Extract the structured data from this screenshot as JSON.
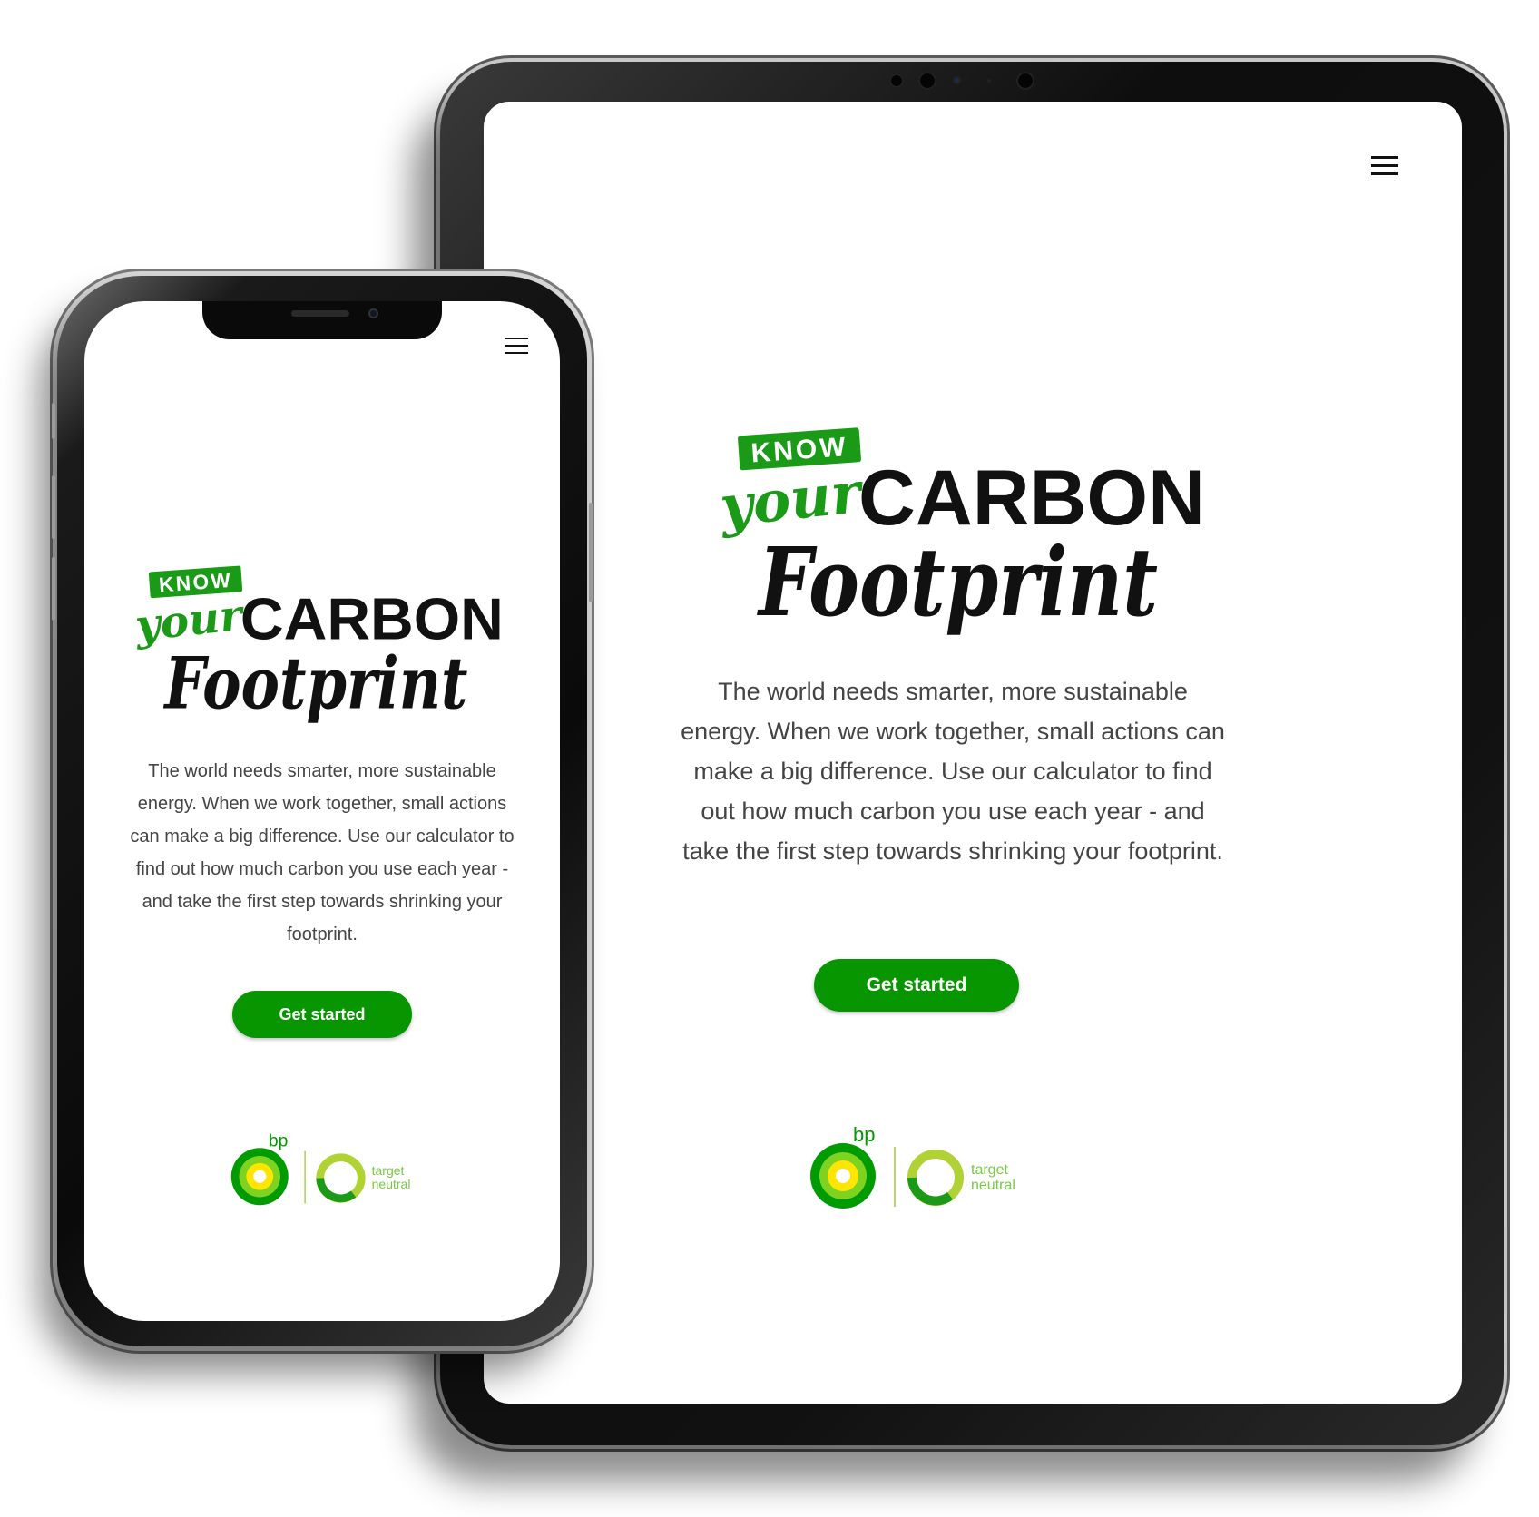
{
  "menu": {
    "icon": "hamburger-menu-icon"
  },
  "logo": {
    "know": "KNOW",
    "your": "your",
    "carbon": "CARBON",
    "footprint": "Footprint"
  },
  "intro": {
    "text": "The world needs smarter, more sustainable energy. When we work together, small actions can make a big difference. Use our calculator to find out how much carbon you use each year - and take the first step towards shrinking your footprint."
  },
  "cta": {
    "label": "Get started"
  },
  "brand": {
    "bp": "bp",
    "target": "target",
    "neutral": "neutral"
  },
  "colors": {
    "brand_green": "#079500",
    "logo_green": "#1a9a17",
    "bp_yellow": "#ffe600",
    "bp_green": "#009b00",
    "target_neutral_green": "#7ac943"
  }
}
